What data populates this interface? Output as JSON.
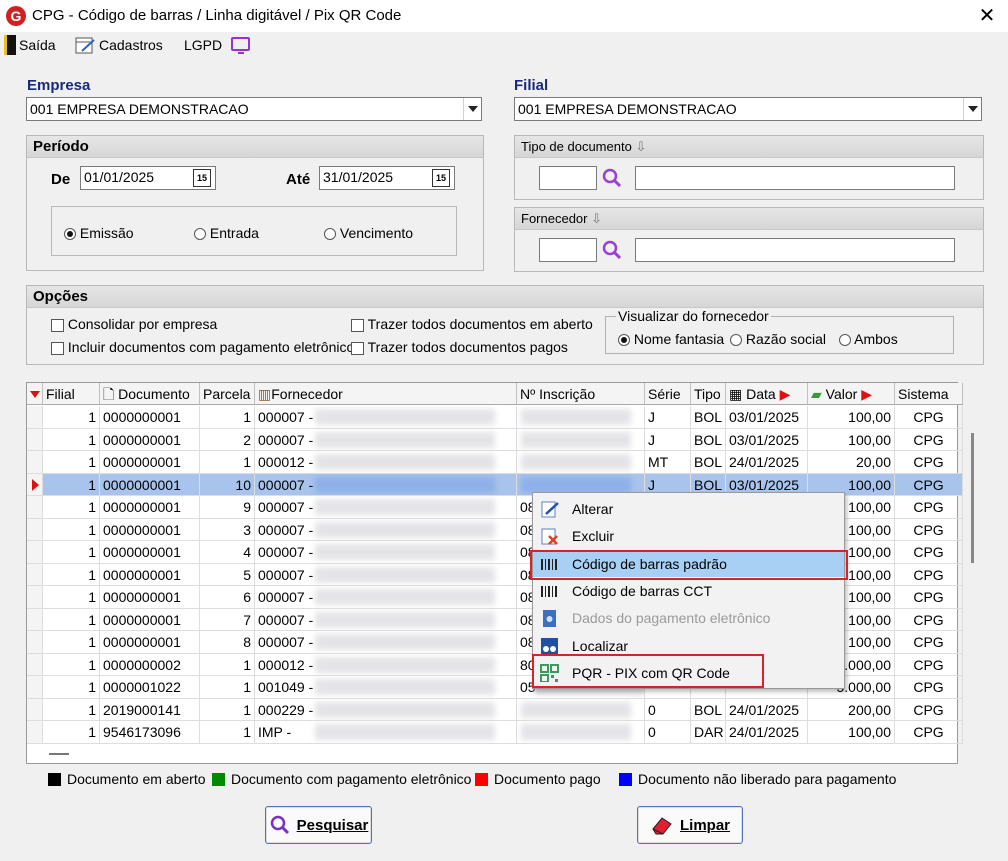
{
  "window": {
    "title": "CPG - Código de barras / Linha digitável / Pix QR Code",
    "logo": "G",
    "close": "✕"
  },
  "toolbar": {
    "saida": "Saída",
    "cadastros": "Cadastros",
    "lgpd": "LGPD"
  },
  "empresa": {
    "label": "Empresa",
    "value": "001 EMPRESA DEMONSTRACAO"
  },
  "filial": {
    "label": "Filial",
    "value": "001 EMPRESA DEMONSTRACAO"
  },
  "periodo": {
    "title": "Período",
    "de_label": "De",
    "de_value": "01/01/2025",
    "ate_label": "Até",
    "ate_value": "31/01/2025",
    "cal_icon": "15",
    "radios": [
      {
        "label": "Emissão",
        "checked": true
      },
      {
        "label": "Entrada",
        "checked": false
      },
      {
        "label": "Vencimento",
        "checked": false
      }
    ]
  },
  "tipo_documento": {
    "title": "Tipo de documento"
  },
  "fornecedor": {
    "title": "Fornecedor"
  },
  "opcoes": {
    "title": "Opções",
    "checks": [
      "Consolidar por empresa",
      "Incluir documentos com pagamento eletrônico",
      "Trazer todos documentos em aberto",
      "Trazer todos documentos pagos"
    ],
    "visualizar": {
      "title": "Visualizar do fornecedor",
      "options": [
        "Nome fantasia",
        "Razão social",
        "Ambos"
      ],
      "selected": "Nome fantasia"
    }
  },
  "grid": {
    "columns": [
      "Filial",
      "Documento",
      "Parcela",
      "Fornecedor",
      "Nº Inscrição",
      "Série",
      "Tipo",
      "Data",
      "Valor",
      "Sistema"
    ],
    "rows": [
      {
        "filial": "1",
        "documento": "0000000001",
        "parcela": "1",
        "fornecedor": "000007 -",
        "inscricao": "",
        "serie": "J",
        "tipo": "BOL",
        "data": "03/01/2025",
        "valor": "100,00",
        "sistema": "CPG"
      },
      {
        "filial": "1",
        "documento": "0000000001",
        "parcela": "2",
        "fornecedor": "000007 -",
        "inscricao": "",
        "serie": "J",
        "tipo": "BOL",
        "data": "03/01/2025",
        "valor": "100,00",
        "sistema": "CPG"
      },
      {
        "filial": "1",
        "documento": "0000000001",
        "parcela": "1",
        "fornecedor": "000012 -",
        "inscricao": "",
        "serie": "MT",
        "tipo": "BOL",
        "data": "24/01/2025",
        "valor": "20,00",
        "sistema": "CPG"
      },
      {
        "filial": "1",
        "documento": "0000000001",
        "parcela": "10",
        "fornecedor": "000007 -",
        "inscricao": "",
        "serie": "J",
        "tipo": "BOL",
        "data": "03/01/2025",
        "valor": "100,00",
        "sistema": "CPG"
      },
      {
        "filial": "1",
        "documento": "0000000001",
        "parcela": "9",
        "fornecedor": "000007 -",
        "inscricao": "08",
        "serie": "",
        "tipo": "",
        "data": "",
        "valor": "100,00",
        "sistema": "CPG"
      },
      {
        "filial": "1",
        "documento": "0000000001",
        "parcela": "3",
        "fornecedor": "000007 -",
        "inscricao": "08",
        "serie": "",
        "tipo": "",
        "data": "",
        "valor": "100,00",
        "sistema": "CPG"
      },
      {
        "filial": "1",
        "documento": "0000000001",
        "parcela": "4",
        "fornecedor": "000007 -",
        "inscricao": "08",
        "serie": "",
        "tipo": "",
        "data": "",
        "valor": "100,00",
        "sistema": "CPG"
      },
      {
        "filial": "1",
        "documento": "0000000001",
        "parcela": "5",
        "fornecedor": "000007 -",
        "inscricao": "08",
        "serie": "",
        "tipo": "",
        "data": "",
        "valor": "100,00",
        "sistema": "CPG"
      },
      {
        "filial": "1",
        "documento": "0000000001",
        "parcela": "6",
        "fornecedor": "000007 -",
        "inscricao": "08",
        "serie": "",
        "tipo": "",
        "data": "",
        "valor": "100,00",
        "sistema": "CPG"
      },
      {
        "filial": "1",
        "documento": "0000000001",
        "parcela": "7",
        "fornecedor": "000007 -",
        "inscricao": "08",
        "serie": "",
        "tipo": "",
        "data": "",
        "valor": "100,00",
        "sistema": "CPG"
      },
      {
        "filial": "1",
        "documento": "0000000001",
        "parcela": "8",
        "fornecedor": "000007 -",
        "inscricao": "08",
        "serie": "",
        "tipo": "",
        "data": "",
        "valor": "100,00",
        "sistema": "CPG"
      },
      {
        "filial": "1",
        "documento": "0000000002",
        "parcela": "1",
        "fornecedor": "000012 -",
        "inscricao": "80",
        "serie": "",
        "tipo": "",
        "data": "",
        "valor": "1.000,00",
        "sistema": "CPG"
      },
      {
        "filial": "1",
        "documento": "0000001022",
        "parcela": "1",
        "fornecedor": "001049 -",
        "inscricao": "05",
        "serie": "",
        "tipo": "",
        "data": "",
        "valor": "5.000,00",
        "sistema": "CPG"
      },
      {
        "filial": "1",
        "documento": "2019000141",
        "parcela": "1",
        "fornecedor": "000229 -",
        "inscricao": "",
        "serie": "0",
        "tipo": "BOL",
        "data": "24/01/2025",
        "valor": "200,00",
        "sistema": "CPG"
      },
      {
        "filial": "1",
        "documento": "9546173096",
        "parcela": "1",
        "fornecedor": "IMP -",
        "inscricao": "",
        "serie": "0",
        "tipo": "DAR",
        "data": "24/01/2025",
        "valor": "100,00",
        "sistema": "CPG"
      }
    ]
  },
  "context_menu": {
    "items": [
      {
        "label": "Alterar",
        "icon": "edit-icon"
      },
      {
        "label": "Excluir",
        "icon": "delete-icon"
      },
      {
        "label": "Código de barras padrão",
        "icon": "barcode-icon",
        "highlighted": true
      },
      {
        "label": "Código de barras CCT",
        "icon": "barcode-icon"
      },
      {
        "label": "Dados do pagamento eletrônico",
        "icon": "payment-icon",
        "disabled": true
      },
      {
        "label": "Localizar",
        "icon": "binoculars-icon"
      },
      {
        "label": "PQR - PIX com QR Code",
        "icon": "qrcode-icon"
      }
    ]
  },
  "legend": [
    {
      "label": "Documento em aberto",
      "color": "#000000"
    },
    {
      "label": "Documento com pagamento eletrônico",
      "color": "#008a00"
    },
    {
      "label": "Documento pago",
      "color": "#ff0000"
    },
    {
      "label": "Documento não liberado para pagamento",
      "color": "#0000ff"
    }
  ],
  "buttons": {
    "pesquisar": "Pesquisar",
    "limpar": "Limpar"
  }
}
